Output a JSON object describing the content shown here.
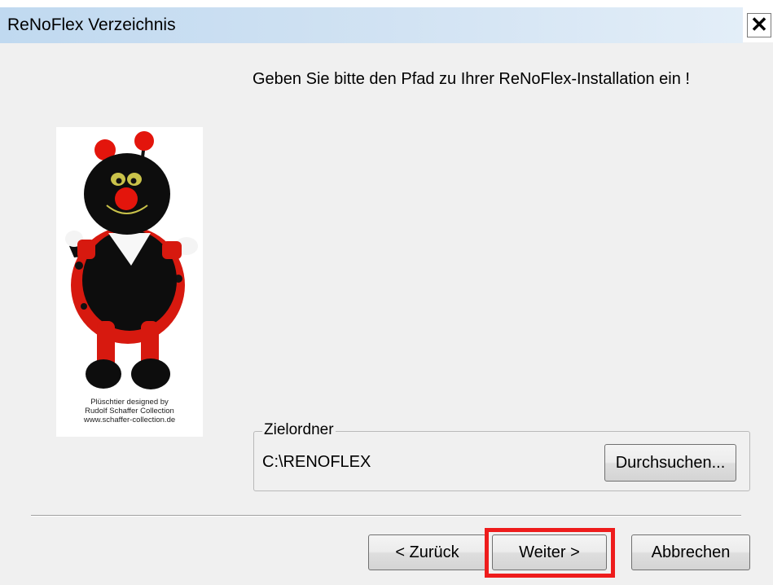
{
  "window": {
    "title": "ReNoFlex Verzeichnis",
    "close_label": "✕"
  },
  "content": {
    "instruction": "Geben Sie bitte den Pfad zu Ihrer ReNoFlex-Installation ein !"
  },
  "mascot": {
    "credit_line1": "Plüschtier designed by",
    "credit_line2": "Rudolf Schaffer Collection",
    "credit_line3": "www.schaffer-collection.de"
  },
  "destination": {
    "group_label": "Zielordner",
    "path": "C:\\RENOFLEX",
    "browse_label": "Durchsuchen..."
  },
  "buttons": {
    "back_label": "< Zurück",
    "next_label": "Weiter >",
    "cancel_label": "Abbrechen"
  },
  "colors": {
    "highlight": "#ee1c1c",
    "title_bar": "#c0d9f0",
    "dialog_bg": "#f0f0f0"
  }
}
